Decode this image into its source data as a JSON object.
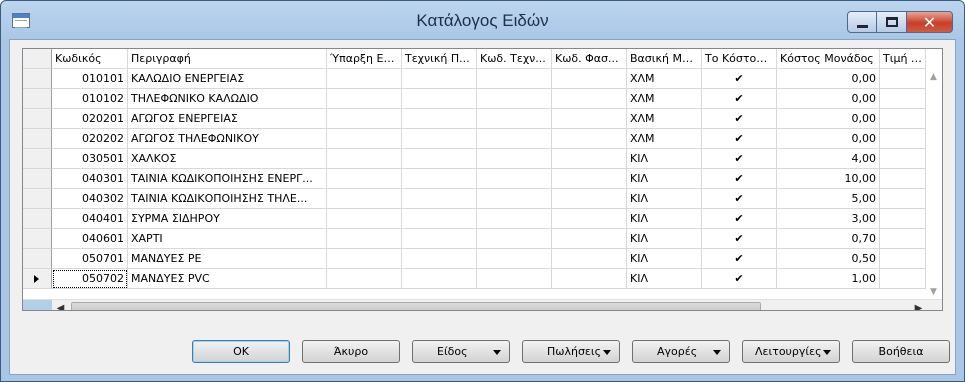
{
  "window": {
    "title": "Κατάλογος Ειδών"
  },
  "grid": {
    "columns": [
      {
        "label": ""
      },
      {
        "label": "Κωδικός"
      },
      {
        "label": "Περιγραφή"
      },
      {
        "label": "Ύπαρξη Εν..."
      },
      {
        "label": "Τεχνική Π..."
      },
      {
        "label": "Κωδ. Τεχν..."
      },
      {
        "label": "Κωδ. Φασ..."
      },
      {
        "label": "Βασική Μο..."
      },
      {
        "label": "Το Κόστος..."
      },
      {
        "label": "Κόστος Μονάδος"
      },
      {
        "label": "Τιμή Μο"
      }
    ],
    "rows": [
      {
        "code": "010101",
        "desc": "ΚΑΛΩΔΙΟ ΕΝΕΡΓΕΙΑΣ",
        "unit": "ΧΛΜ",
        "check": "✔",
        "cost": "0,00",
        "current": false
      },
      {
        "code": "010102",
        "desc": "ΤΗΛΕΦΩΝΙΚΟ ΚΑΛΩΔΙΟ",
        "unit": "ΧΛΜ",
        "check": "✔",
        "cost": "0,00",
        "current": false
      },
      {
        "code": "020201",
        "desc": "ΑΓΩΓΟΣ ΕΝΕΡΓΕΙΑΣ",
        "unit": "ΧΛΜ",
        "check": "✔",
        "cost": "0,00",
        "current": false
      },
      {
        "code": "020202",
        "desc": "ΑΓΩΓΟΣ ΤΗΛΕΦΩΝΙΚΟΥ",
        "unit": "ΧΛΜ",
        "check": "✔",
        "cost": "0,00",
        "current": false
      },
      {
        "code": "030501",
        "desc": "ΧΑΛΚΟΣ",
        "unit": "ΚΙΛ",
        "check": "✔",
        "cost": "4,00",
        "current": false
      },
      {
        "code": "040301",
        "desc": "ΤΑΙΝΙΑ ΚΩΔΙΚΟΠΟΙΗΣΗΣ ΕΝΕΡΓ...",
        "unit": "ΚΙΛ",
        "check": "✔",
        "cost": "10,00",
        "current": false
      },
      {
        "code": "040302",
        "desc": "ΤΑΙΝΙΑ ΚΩΔΙΚΟΠΟΙΗΣΗΣ ΤΗΛΕ...",
        "unit": "ΚΙΛ",
        "check": "✔",
        "cost": "5,00",
        "current": false
      },
      {
        "code": "040401",
        "desc": "ΣΥΡΜΑ ΣΙΔΗΡΟΥ",
        "unit": "ΚΙΛ",
        "check": "✔",
        "cost": "3,00",
        "current": false
      },
      {
        "code": "040601",
        "desc": "ΧΑΡΤΙ",
        "unit": "ΚΙΛ",
        "check": "✔",
        "cost": "0,70",
        "current": false
      },
      {
        "code": "050701",
        "desc": "ΜΑΝΔΥΕΣ ΡΕ",
        "unit": "ΚΙΛ",
        "check": "✔",
        "cost": "0,50",
        "current": false
      },
      {
        "code": "050702",
        "desc": "ΜΑΝΔΥΕΣ PVC",
        "unit": "ΚΙΛ",
        "check": "✔",
        "cost": "1,00",
        "current": true
      }
    ]
  },
  "buttons": {
    "ok": "OK",
    "cancel": "Άκυρο",
    "items": "Είδος",
    "sales": "Πωλήσεις",
    "purchases": "Αγορές",
    "functions": "Λειτουργίες",
    "help": "Βοήθεια"
  },
  "icons": {
    "app": "catalog-window-icon",
    "minimize": "minimize-icon",
    "maximize": "maximize-icon",
    "close": "close-icon"
  }
}
